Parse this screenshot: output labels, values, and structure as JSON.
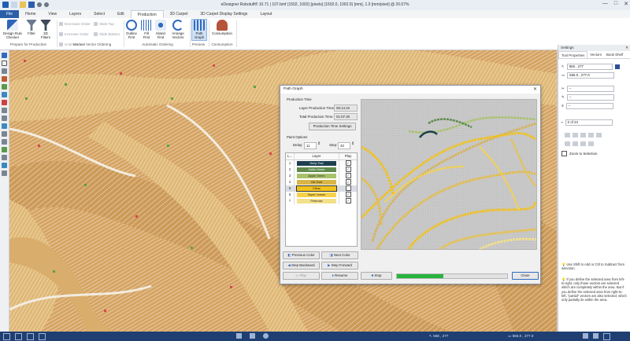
{
  "window": {
    "title": "eDesigner Robotuft® 10.71 | 107.bmf (1502, 1002) [pixels] (1502.0, 1002.0) [mm], 1.0 [mm/pixel] @ 20.07%",
    "controls": [
      "—",
      "□",
      "✕"
    ]
  },
  "tabs": [
    "File",
    "Home",
    "View",
    "Layers",
    "Select",
    "Edit",
    "Production",
    "3D Carpet",
    "3D Carpet Display Settings",
    "Layout"
  ],
  "active_tab": "Production",
  "ribbon": {
    "prepare": {
      "design_rule_checker": "Design Rule\nChecker",
      "filter": "Filter",
      "filters_3d": "3D\nFilters",
      "group": "Prepare for Production"
    },
    "manual": {
      "decrease_order": "Decrease Order",
      "increase_order": "Increase Order",
      "undo_order": "Undo Order",
      "slide_top": "Slide Top",
      "slide_bottom": "Slide Bottom",
      "group": "Manual Vector Ordering"
    },
    "auto": {
      "outline_first": "Outline\nFirst",
      "fill_first": "Fill\nFirst",
      "island_first": "Island\nFirst",
      "arrange_vectors": "Arrange\nVectors",
      "group": "Automatic Ordering"
    },
    "preview": {
      "path_graph": "Path\nGraph",
      "group": "Preview"
    },
    "consumption": {
      "consumption": "Consumption",
      "group": "Consumption"
    }
  },
  "settings": {
    "header": "Settings",
    "tabs": [
      "Tool Properties",
      "Vectors",
      "Book Shelf"
    ],
    "pos1": "556 , 277",
    "pos2": "556.0 , 277.0",
    "dash1": "--",
    "dash2": "--",
    "dash3": "--",
    "count": "0 of 24",
    "zoom_to_selection": "Zoom to Selection",
    "tip1": "Use Shift to Add or Ctrl to Subtract from selection.",
    "tip2": "If you define the selected area from left-to-right, only those vectors are selected which are completely within the area. But if you define the selected area from right-to-left, \"partial\" vectors are also selected, which only partially lie within the area."
  },
  "dialog": {
    "title": "Path Graph",
    "production_time": "Production Time",
    "layer_production_time_label": "Layer Production Time:",
    "layer_production_time": "00:14:10",
    "total_production_time_label": "Total Production Time:",
    "total_production_time": "01:07:30",
    "production_time_settings": "Production Time Settings",
    "paint_options": "Paint Options",
    "delay_label": "Delay:",
    "delay_value": "11",
    "step_label": "Step:",
    "step_value": "40",
    "table_headers": [
      "L...",
      "Layer",
      "Play"
    ],
    "layers": [
      {
        "num": "1",
        "name": "Deep Teal",
        "color": "#1d3f4f",
        "text": "#ffffff",
        "play": true
      },
      {
        "num": "2",
        "name": "Celtic Green",
        "color": "#5f8a4c",
        "text": "#ffffff",
        "play": true
      },
      {
        "num": "3",
        "name": "Apple Green",
        "color": "#a9c26a",
        "text": "#222222",
        "play": true
      },
      {
        "num": "4",
        "name": "Citi Gold",
        "color": "#d9b545",
        "text": "#222222",
        "play": true
      },
      {
        "num": "5",
        "name": "Citrus",
        "color": "#f2c21b",
        "text": "#222222",
        "play": false
      },
      {
        "num": "6",
        "name": "Super Lemon",
        "color": "#f6d24a",
        "text": "#222222",
        "play": true
      },
      {
        "num": "7",
        "name": "Primrose",
        "color": "#f3e08a",
        "text": "#222222",
        "play": true
      }
    ],
    "previous_color": "Previous Color",
    "next_color": "Next Color",
    "step_backward": "Step Backward",
    "step_forward": "Step Forward",
    "play": "Play",
    "resume": "Resume",
    "stop": "Stop",
    "close": "Close",
    "progress": 0.42
  },
  "status": {
    "coords1": "556 , 277",
    "coords2": "556.0 , 277.0"
  }
}
